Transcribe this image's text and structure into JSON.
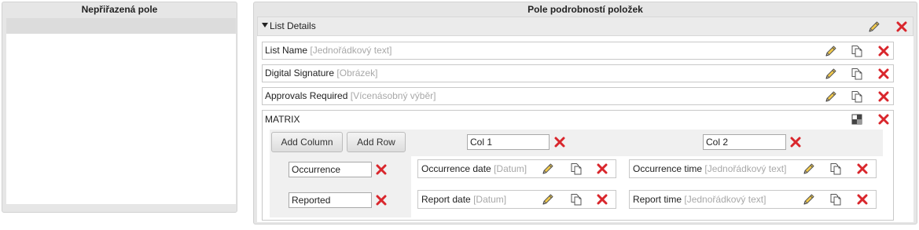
{
  "left_panel": {
    "title": "Nepřiřazená pole"
  },
  "right_panel": {
    "title": "Pole podrobností položek",
    "section": {
      "title": "List Details",
      "toggle_icon": "triangle-down-icon"
    },
    "fields": [
      {
        "name": "List Name",
        "type": "[Jednořádkový text]"
      },
      {
        "name": "Digital Signature",
        "type": "[Obrázek]"
      },
      {
        "name": "Approvals Required",
        "type": "[Vícenásobný výběr]"
      }
    ],
    "matrix": {
      "label": "MATRIX",
      "add_column_label": "Add Column",
      "add_row_label": "Add Row",
      "columns": [
        "Col 1",
        "Col 2"
      ],
      "rows": [
        "Occurrence",
        "Reported"
      ],
      "cells": [
        [
          {
            "name": "Occurrence date",
            "type": "[Datum]"
          },
          {
            "name": "Occurrence time",
            "type": "[Jednořádkový text]"
          }
        ],
        [
          {
            "name": "Report date",
            "type": "[Datum]"
          },
          {
            "name": "Report time",
            "type": "[Jednořádkový text]"
          }
        ]
      ]
    }
  },
  "icons": {
    "edit": "pencil-icon",
    "copy": "copy-icon",
    "delete": "delete-x-icon",
    "matrix_settings": "matrix-settings-icon"
  },
  "colors": {
    "delete_red": "#d9262c",
    "pencil_yellow": "#f0c84a",
    "panel_bg": "#e6e6e6"
  }
}
